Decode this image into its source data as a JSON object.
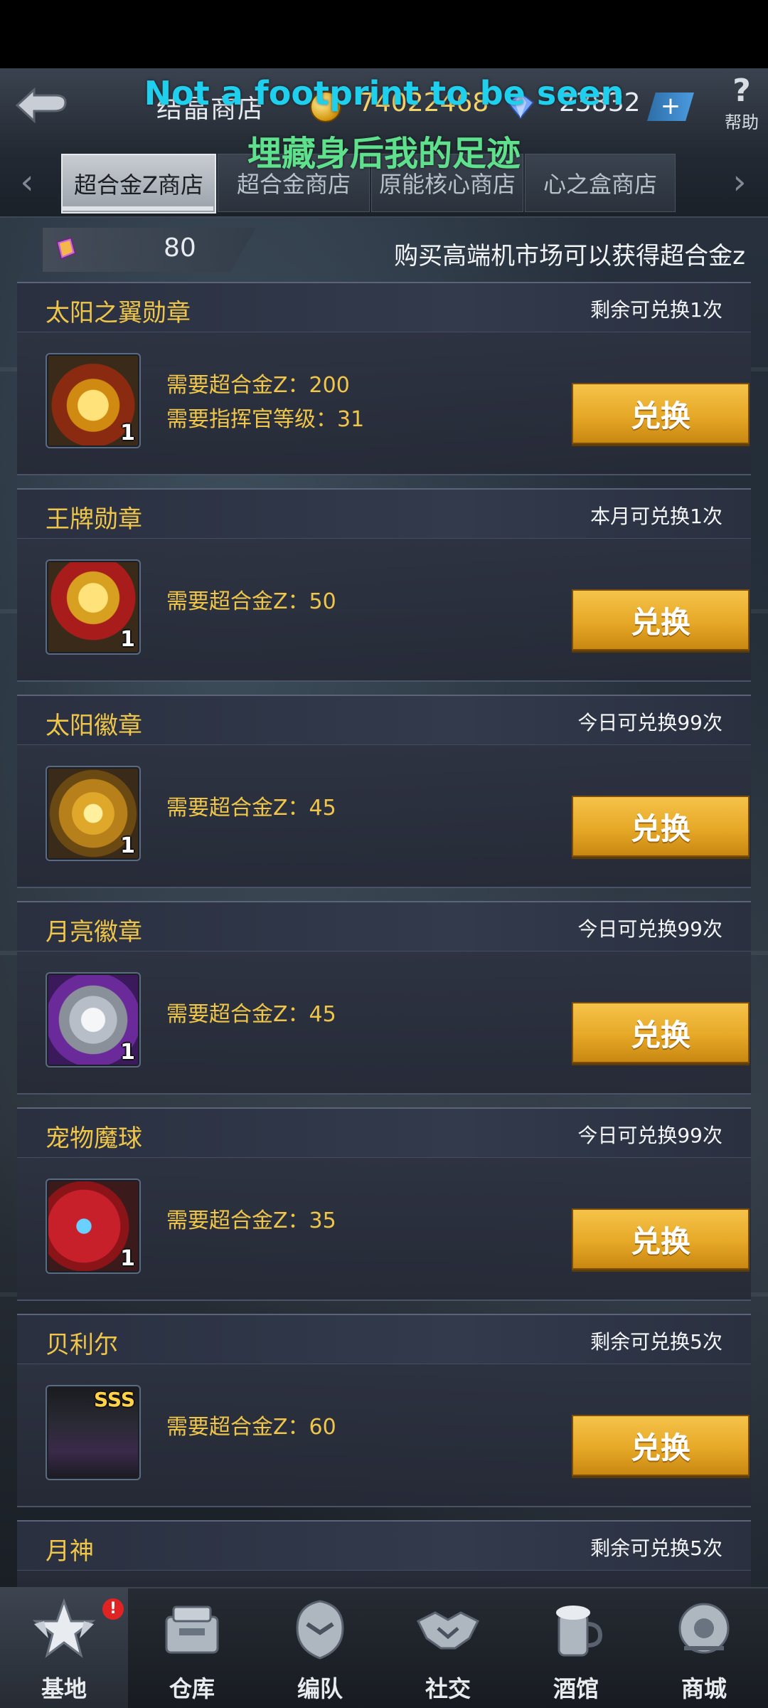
{
  "header": {
    "title": "结晶商店",
    "coin_value": "74022468",
    "gem_value": "23832",
    "plus_label": "+",
    "help_symbol": "?",
    "help_label": "帮助"
  },
  "overlay": {
    "lyric_en": "Not a footprint to be seen",
    "lyric_zh": "埋藏身后我的足迹"
  },
  "tabs": [
    {
      "label": "超合金Z商店",
      "active": true
    },
    {
      "label": "超合金商店",
      "active": false
    },
    {
      "label": "原能核心商店",
      "active": false
    },
    {
      "label": "心之盒商店",
      "active": false
    }
  ],
  "currency": {
    "value": "80",
    "info": "购买高端机市场可以获得超合金z"
  },
  "items": [
    {
      "name": "太阳之翼勋章",
      "limit": "剩余可兑换1次",
      "req1": "需要超合金Z：200",
      "req2": "需要指挥官等级：31",
      "count": "1",
      "button": "兑换"
    },
    {
      "name": "王牌勋章",
      "limit": "本月可兑换1次",
      "req1": "需要超合金Z：50",
      "req2": "",
      "count": "1",
      "button": "兑换"
    },
    {
      "name": "太阳徽章",
      "limit": "今日可兑换99次",
      "req1": "需要超合金Z：45",
      "req2": "",
      "count": "1",
      "button": "兑换"
    },
    {
      "name": "月亮徽章",
      "limit": "今日可兑换99次",
      "req1": "需要超合金Z：45",
      "req2": "",
      "count": "1",
      "button": "兑换"
    },
    {
      "name": "宠物魔球",
      "limit": "今日可兑换99次",
      "req1": "需要超合金Z：35",
      "req2": "",
      "count": "1",
      "button": "兑换"
    },
    {
      "name": "贝利尔",
      "limit": "剩余可兑换5次",
      "req1": "需要超合金Z：60",
      "req2": "",
      "count": "SSS",
      "button": "兑换"
    },
    {
      "name": "月神",
      "limit": "剩余可兑换5次",
      "req1": "",
      "req2": "",
      "count": "",
      "button": ""
    }
  ],
  "nav": [
    {
      "label": "基地",
      "icon": "base-star-icon",
      "active": true,
      "badge": "!"
    },
    {
      "label": "仓库",
      "icon": "warehouse-icon",
      "active": false,
      "badge": ""
    },
    {
      "label": "编队",
      "icon": "formation-icon",
      "active": false,
      "badge": ""
    },
    {
      "label": "社交",
      "icon": "handshake-icon",
      "active": false,
      "badge": ""
    },
    {
      "label": "酒馆",
      "icon": "tavern-icon",
      "active": false,
      "badge": ""
    },
    {
      "label": "商城",
      "icon": "mall-icon",
      "active": false,
      "badge": ""
    }
  ],
  "colors": {
    "accent_gold": "#f0c64a",
    "button_gold": "#e6a827",
    "lyric_cyan": "#1fd0ee",
    "lyric_green": "#5ee08c",
    "badge_red": "#e02424"
  }
}
